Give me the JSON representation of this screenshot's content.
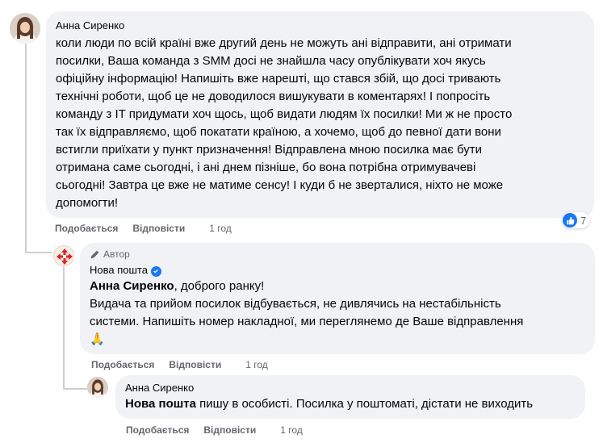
{
  "comment1": {
    "author": "Анна Сиренко",
    "lines": [
      "коли люди по всій країні вже другий день не можуть ані відправити, ані отримати",
      "посилки, Ваша команда з SMM досі не знайшла часу опублікувати хоч якусь",
      "офіційну інформацію! Напишіть вже нарешті, що стався збій, що досі тривають",
      "технічні роботи, щоб це не доводилося вишукувати в коментарях! І попросіть",
      "команду з IT придумати хоч щось, щоб видати людям їх посилки! Ми ж не просто",
      "так їх відправляємо, щоб покатати країною, а хочемо, щоб до певної дати вони",
      "встигли приїхати у пункт призначення! Відправлена мною посилка має бути",
      "отримана саме сьогодні, і ані днем пізніше, бо вона потрібна отримувачеві",
      "сьогодні! Завтра це вже не матиме сенсу! І куди б не зверталися, ніхто не може",
      "допомогти!"
    ],
    "like_label": "Подобається",
    "reply_label": "Відповісти",
    "time": "1 год",
    "reaction_count": "7",
    "reaction_icon": "thumbs-up-icon"
  },
  "reply1": {
    "tag": "Автор",
    "author": "Нова пошта",
    "verified_icon": "verified-check-icon",
    "mention": "Анна Сиренко",
    "greeting": ", доброго ранку!",
    "lines": [
      "Видача та прийом посилок відбувається, не дивлячись на нестабільність",
      "системи. Напишіть номер накладної, ми переглянемо де Ваше відправлення"
    ],
    "emoji": "🙏",
    "like_label": "Подобається",
    "reply_label": "Відповісти",
    "time": "1 год"
  },
  "reply2": {
    "author": "Анна Сиренко",
    "mention": "Нова пошта",
    "text": " пишу в особисті. Посилка у поштоматі, дістати не виходить",
    "like_label": "Подобається",
    "reply_label": "Відповісти",
    "time": "1 год"
  },
  "colors": {
    "bubble": "#f0f2f5",
    "meta": "#65676b",
    "accent": "#1877f2",
    "thread_line": "#ccd0d5"
  }
}
